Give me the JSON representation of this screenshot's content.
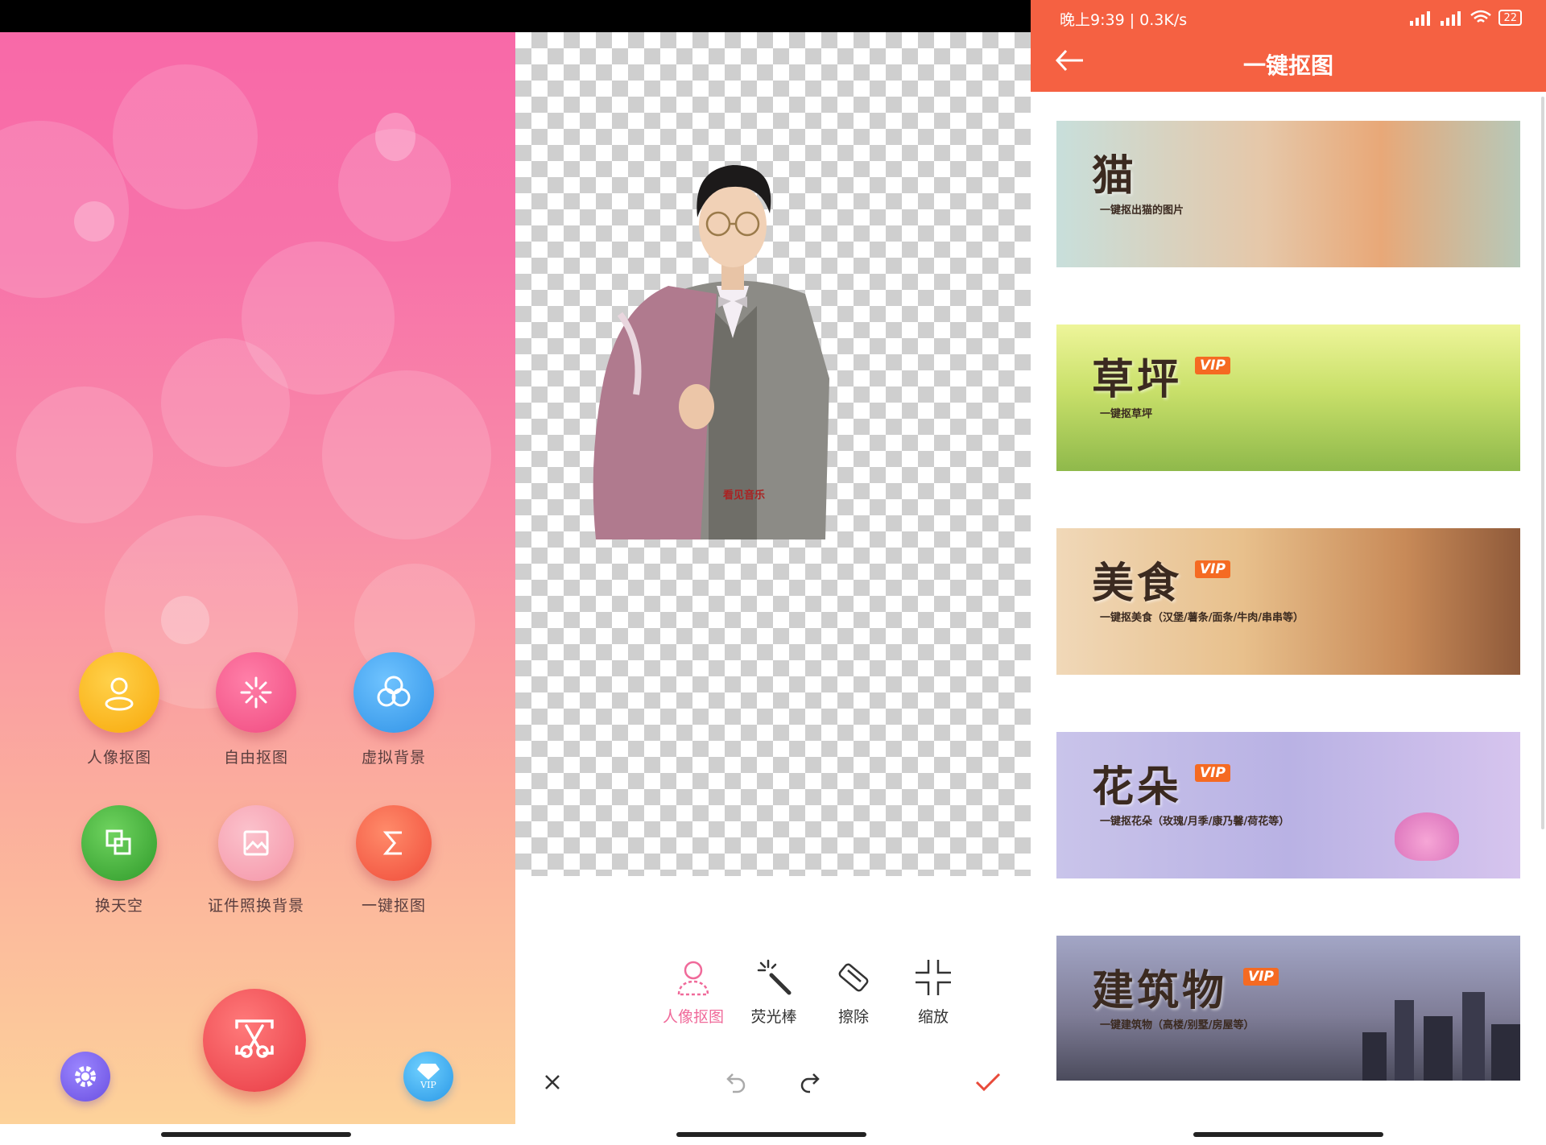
{
  "panel1": {
    "tiles": [
      {
        "label": "人像抠图",
        "icon": "person-icon",
        "color": "#f8b70e"
      },
      {
        "label": "自由抠图",
        "icon": "sparkle-icon",
        "color": "#f45a8d"
      },
      {
        "label": "虚拟背景",
        "icon": "circles-icon",
        "color": "#47a9f0"
      },
      {
        "label": "换天空",
        "icon": "layers-icon",
        "color": "#3ea734"
      },
      {
        "label": "证件照换背景",
        "icon": "picture-icon",
        "color": "#f7a3b4"
      },
      {
        "label": "一键抠图",
        "icon": "sigma-icon",
        "color": "#f55a45"
      }
    ],
    "settings_icon": "gear-icon",
    "vip_icon": "diamond-icon",
    "vip_label": "VIP",
    "center_icon": "scissors-icon"
  },
  "panel2": {
    "watermark": "看见音乐",
    "tools": [
      {
        "label": "人像抠图",
        "icon": "person-outline-icon",
        "active": true
      },
      {
        "label": "荧光棒",
        "icon": "magic-wand-icon",
        "active": false
      },
      {
        "label": "擦除",
        "icon": "eraser-icon",
        "active": false
      },
      {
        "label": "缩放",
        "icon": "shrink-icon",
        "active": false
      }
    ],
    "colors": {
      "active": "#f06a9a",
      "confirm": "#e84a3a"
    }
  },
  "panel3": {
    "status_time": "晚上9:39 | 0.3K/s",
    "battery": "22",
    "title": "一键抠图",
    "accent": "#f56142",
    "banners": [
      {
        "title": "猫",
        "subtitle": "一键抠出猫的图片",
        "vip": false
      },
      {
        "title": "草坪",
        "subtitle": "一键抠草坪",
        "vip": true
      },
      {
        "title": "美食",
        "subtitle": "一键抠美食（汉堡/薯条/面条/牛肉/串串等）",
        "vip": true
      },
      {
        "title": "花朵",
        "subtitle": "一键抠花朵（玫瑰/月季/康乃馨/荷花等）",
        "vip": true
      },
      {
        "title": "建筑物",
        "subtitle": "一键建筑物（高楼/别墅/房屋等）",
        "vip": true
      }
    ],
    "vip_label": "VIP"
  }
}
